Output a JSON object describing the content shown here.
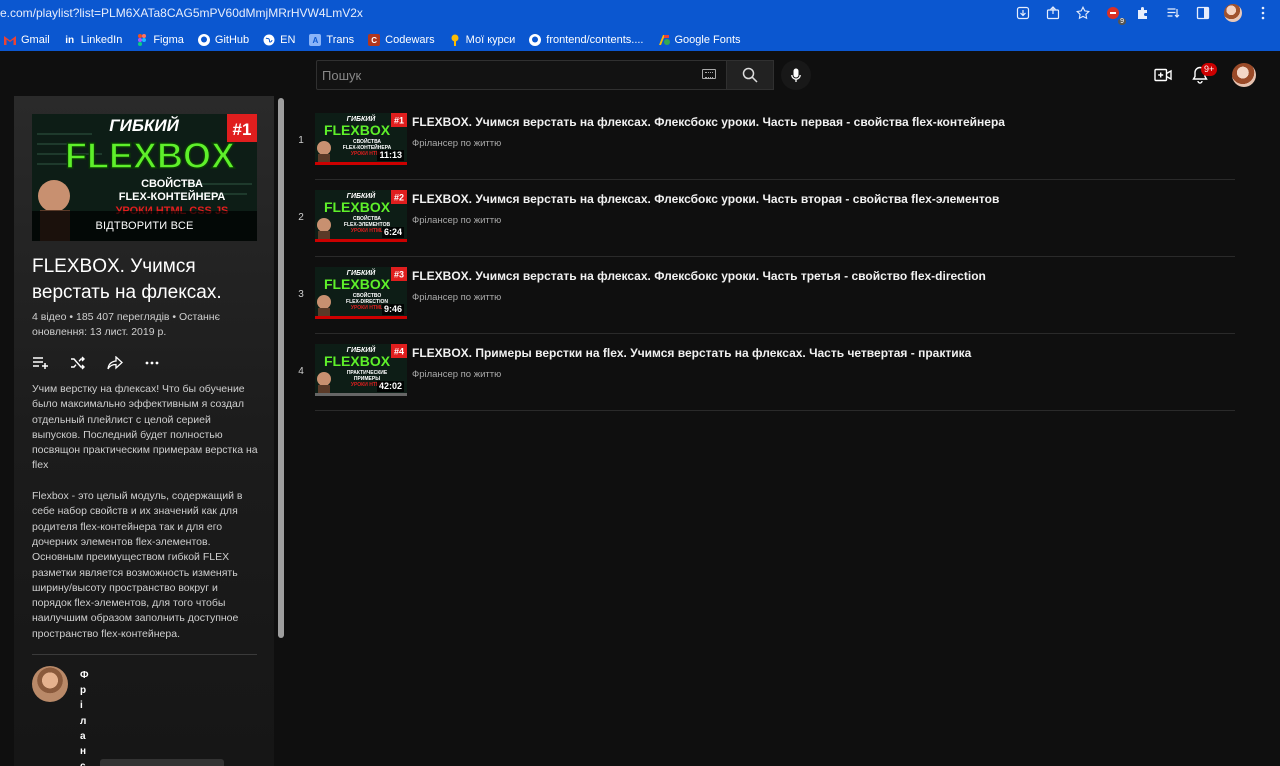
{
  "browser": {
    "url": "e.com/playlist?list=PLM6XATa8CAG5mPV60dMmjMRrHVW4LmV2x",
    "extension_badge": "9",
    "bookmarks": [
      {
        "label": "Gmail",
        "icon": "gmail-icon",
        "color": "#ea4335"
      },
      {
        "label": "LinkedIn",
        "icon": "linkedin-icon",
        "color": "#ffffff"
      },
      {
        "label": "Figma",
        "icon": "figma-icon",
        "color": "#f24e1e"
      },
      {
        "label": "GitHub",
        "icon": "github-icon",
        "color": "#ffffff"
      },
      {
        "label": "EN",
        "icon": "globe-icon",
        "color": "#ffffff"
      },
      {
        "label": "Trans",
        "icon": "translate-icon",
        "color": "#8ab4f8"
      },
      {
        "label": "Codewars",
        "icon": "codewars-icon",
        "color": "#b1361e"
      },
      {
        "label": "Мої курси",
        "icon": "courses-icon",
        "color": "#fbbc04"
      },
      {
        "label": "frontend/contents....",
        "icon": "github-icon",
        "color": "#ffffff"
      },
      {
        "label": "Google Fonts",
        "icon": "google-fonts-icon",
        "color": "#fbbc04"
      }
    ]
  },
  "header": {
    "search_placeholder": "Пошук",
    "notification_count": "9+"
  },
  "playlist": {
    "play_all": "ВІДТВОРИТИ ВСЕ",
    "thumb": {
      "small": "ГИБКИЙ",
      "big": "FLEXBOX",
      "badge": "#1",
      "line1": "СВОЙСТВА",
      "line2": "FLEX-КОНТЕЙНЕРА",
      "line3": "УРОКИ HTML CSS JS"
    },
    "title": "FLEXBOX. Учимся верстать на флексах.",
    "meta": "4 відео • 185 407 переглядів • Останнє оновлення: 13 лист. 2019 р.",
    "description": "Учим верстку на флексах! Что бы обучение было максимально эффективным я создал отдельный плейлист с целой серией выпусков. Последний будет полностью посвящон практическим примерам верстка на flex\n\nFlexbox - это целый модуль, содержащий в себе набор свойств и их значений как для родителя flex-контейнера так и для его дочерних элементов flex-элементов. Основным преимуществом гибкой FLEX разметки является возможность изменять ширину/высоту пространство вокруг и порядок flex-элементов, для того чтобы наилучшим образом заполнить доступное пространство flex-контейнера.",
    "owner": "Фріланс"
  },
  "videos": [
    {
      "index": "1",
      "title": "FLEXBOX. Учимся верстать на флексах. Флексбокс уроки. Часть первая - свойства flex-контейнера",
      "channel": "Фрілансер по життю",
      "duration": "11:13",
      "thumb": {
        "small": "ГИБКИЙ",
        "big": "FLEXBOX",
        "badge": "#1",
        "line1": "СВОЙСТВА",
        "line2": "FLEX-КОНТЕЙНЕРА",
        "line3": "УРОКИ HTML"
      }
    },
    {
      "index": "2",
      "title": "FLEXBOX. Учимся верстать на флексах. Флексбокс уроки. Часть вторая - свойства flex-элементов",
      "channel": "Фрілансер по життю",
      "duration": "6:24",
      "thumb": {
        "small": "ГИБКИЙ",
        "big": "FLEXBOX",
        "badge": "#2",
        "line1": "СВОЙСТВА",
        "line2": "FLEX-ЭЛЕМЕНТОВ",
        "line3": "УРОКИ HTML"
      }
    },
    {
      "index": "3",
      "title": "FLEXBOX. Учимся верстать на флексах. Флексбокс уроки. Часть третья - свойство flex-direction",
      "channel": "Фрілансер по життю",
      "duration": "9:46",
      "thumb": {
        "small": "ГИБКИЙ",
        "big": "FLEXBOX",
        "badge": "#3",
        "line1": "СВОЙСТВО",
        "line2": "FLEX-DIRECTION",
        "line3": "УРОКИ HTML"
      }
    },
    {
      "index": "4",
      "title": "FLEXBOX. Примеры верстки на flex. Учимся верстать на флексах. Часть четвертая - практика",
      "channel": "Фрілансер по життю",
      "duration": "42:02",
      "thumb": {
        "small": "ГИБКИЙ",
        "big": "FLEXBOX",
        "badge": "#4",
        "line1": "ПРАКТИЧЕСКИЕ",
        "line2": "ПРИМЕРЫ",
        "line3": "УРОКИ HTML"
      }
    }
  ],
  "colors": {
    "accent_green": "#5ef02a",
    "badge_red": "#e01e1e",
    "bg": "#0f0f0f"
  }
}
